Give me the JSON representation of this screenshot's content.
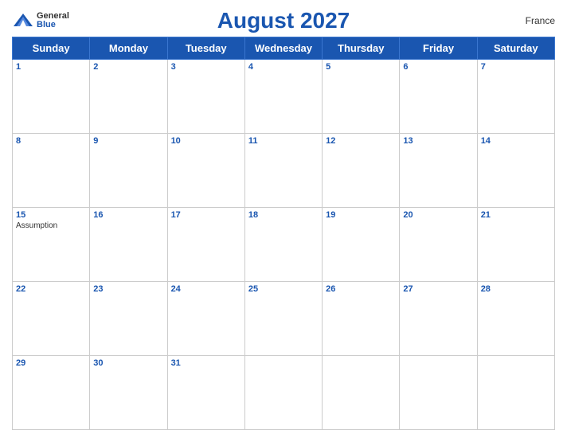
{
  "header": {
    "title": "August 2027",
    "country": "France",
    "logo_general": "General",
    "logo_blue": "Blue"
  },
  "days_of_week": [
    "Sunday",
    "Monday",
    "Tuesday",
    "Wednesday",
    "Thursday",
    "Friday",
    "Saturday"
  ],
  "weeks": [
    [
      {
        "day": "1",
        "events": []
      },
      {
        "day": "2",
        "events": []
      },
      {
        "day": "3",
        "events": []
      },
      {
        "day": "4",
        "events": []
      },
      {
        "day": "5",
        "events": []
      },
      {
        "day": "6",
        "events": []
      },
      {
        "day": "7",
        "events": []
      }
    ],
    [
      {
        "day": "8",
        "events": []
      },
      {
        "day": "9",
        "events": []
      },
      {
        "day": "10",
        "events": []
      },
      {
        "day": "11",
        "events": []
      },
      {
        "day": "12",
        "events": []
      },
      {
        "day": "13",
        "events": []
      },
      {
        "day": "14",
        "events": []
      }
    ],
    [
      {
        "day": "15",
        "events": [
          "Assumption"
        ]
      },
      {
        "day": "16",
        "events": []
      },
      {
        "day": "17",
        "events": []
      },
      {
        "day": "18",
        "events": []
      },
      {
        "day": "19",
        "events": []
      },
      {
        "day": "20",
        "events": []
      },
      {
        "day": "21",
        "events": []
      }
    ],
    [
      {
        "day": "22",
        "events": []
      },
      {
        "day": "23",
        "events": []
      },
      {
        "day": "24",
        "events": []
      },
      {
        "day": "25",
        "events": []
      },
      {
        "day": "26",
        "events": []
      },
      {
        "day": "27",
        "events": []
      },
      {
        "day": "28",
        "events": []
      }
    ],
    [
      {
        "day": "29",
        "events": []
      },
      {
        "day": "30",
        "events": []
      },
      {
        "day": "31",
        "events": []
      },
      {
        "day": "",
        "events": []
      },
      {
        "day": "",
        "events": []
      },
      {
        "day": "",
        "events": []
      },
      {
        "day": "",
        "events": []
      }
    ]
  ]
}
